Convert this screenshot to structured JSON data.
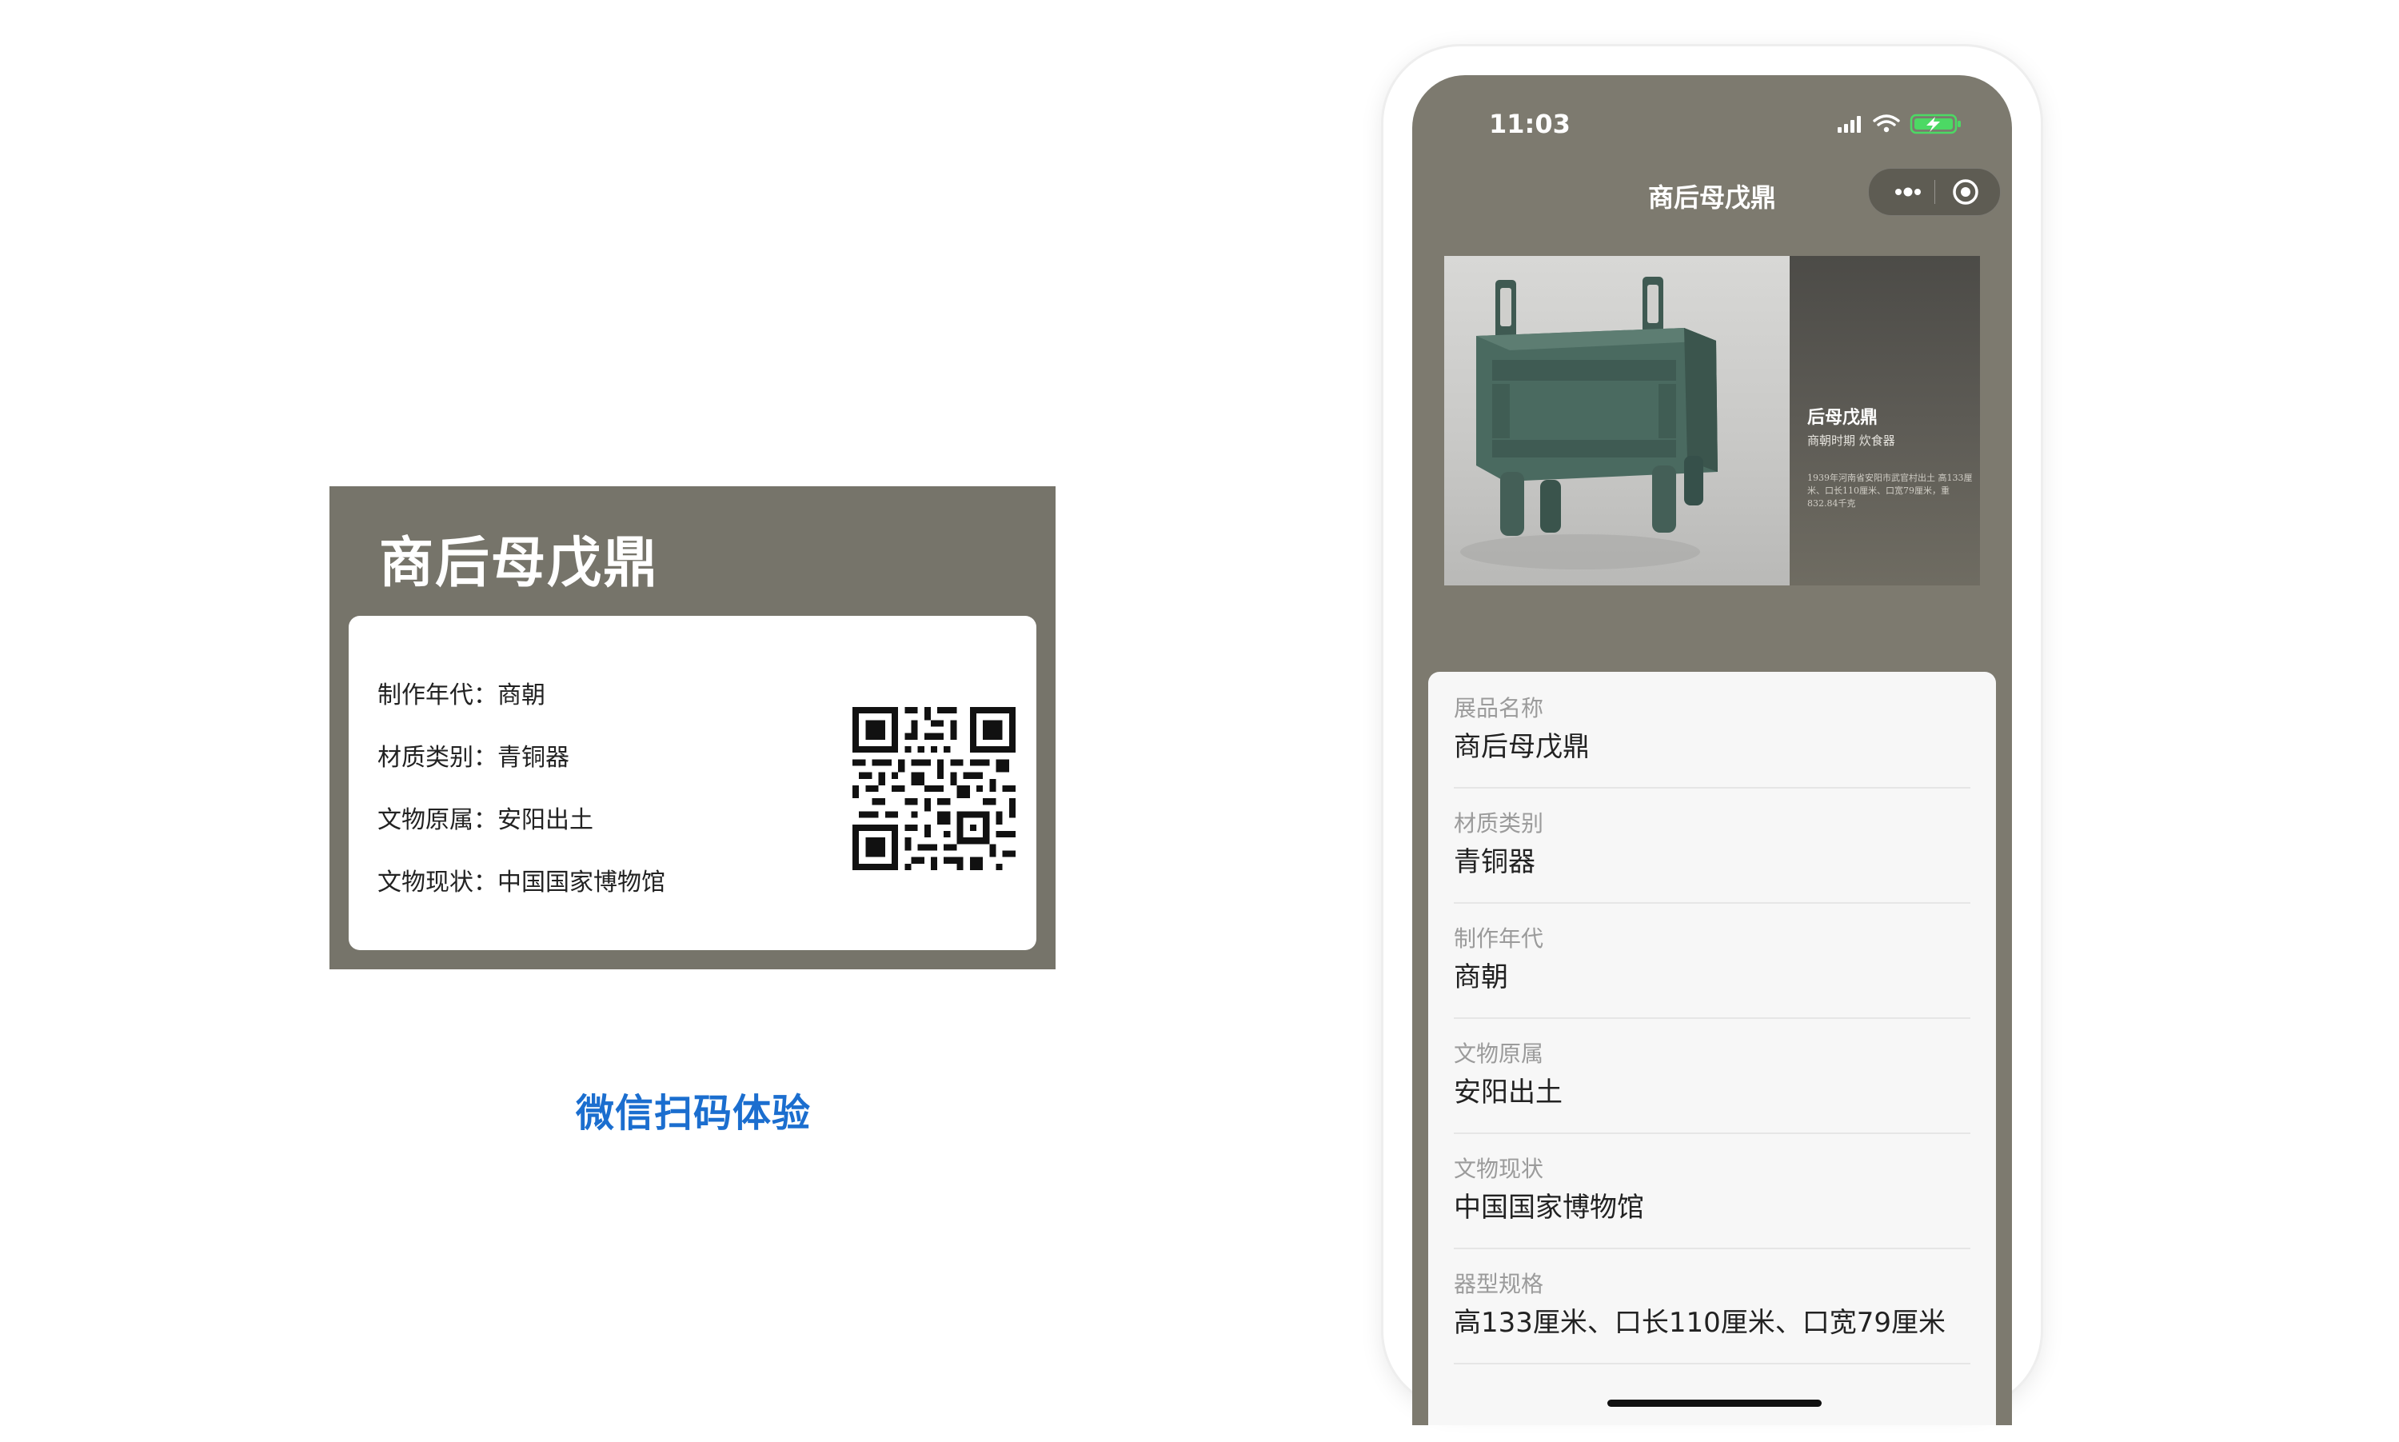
{
  "card": {
    "title": "商后母戊鼎",
    "rows": [
      {
        "key": "制作年代",
        "value": "商朝"
      },
      {
        "key": "材质类别",
        "value": "青铜器"
      },
      {
        "key": "文物原属",
        "value": "安阳出土"
      },
      {
        "key": "文物现状",
        "value": "中国国家博物馆"
      }
    ]
  },
  "scan_hint": "微信扫码体验",
  "phone": {
    "status_time": "11:03",
    "nav_title": "商后母戊鼎",
    "banner": {
      "name": "后母戊鼎",
      "period": "商朝时期 炊食器",
      "desc": "1939年河南省安阳市武官村出土 高133厘米、口长110厘米、口宽79厘米，重832.84千克"
    },
    "fields": [
      {
        "label": "展品名称",
        "value": "商后母戊鼎"
      },
      {
        "label": "材质类别",
        "value": "青铜器"
      },
      {
        "label": "制作年代",
        "value": "商朝"
      },
      {
        "label": "文物原属",
        "value": "安阳出土"
      },
      {
        "label": "文物现状",
        "value": "中国国家博物馆"
      },
      {
        "label": "器型规格",
        "value": "高133厘米、口长110厘米、口宽79厘米"
      }
    ]
  },
  "colors": {
    "card_bg": "#76746a",
    "screen_bg": "#7d7a6f",
    "link_blue": "#1b6ecf",
    "battery_green": "#4cd964"
  }
}
